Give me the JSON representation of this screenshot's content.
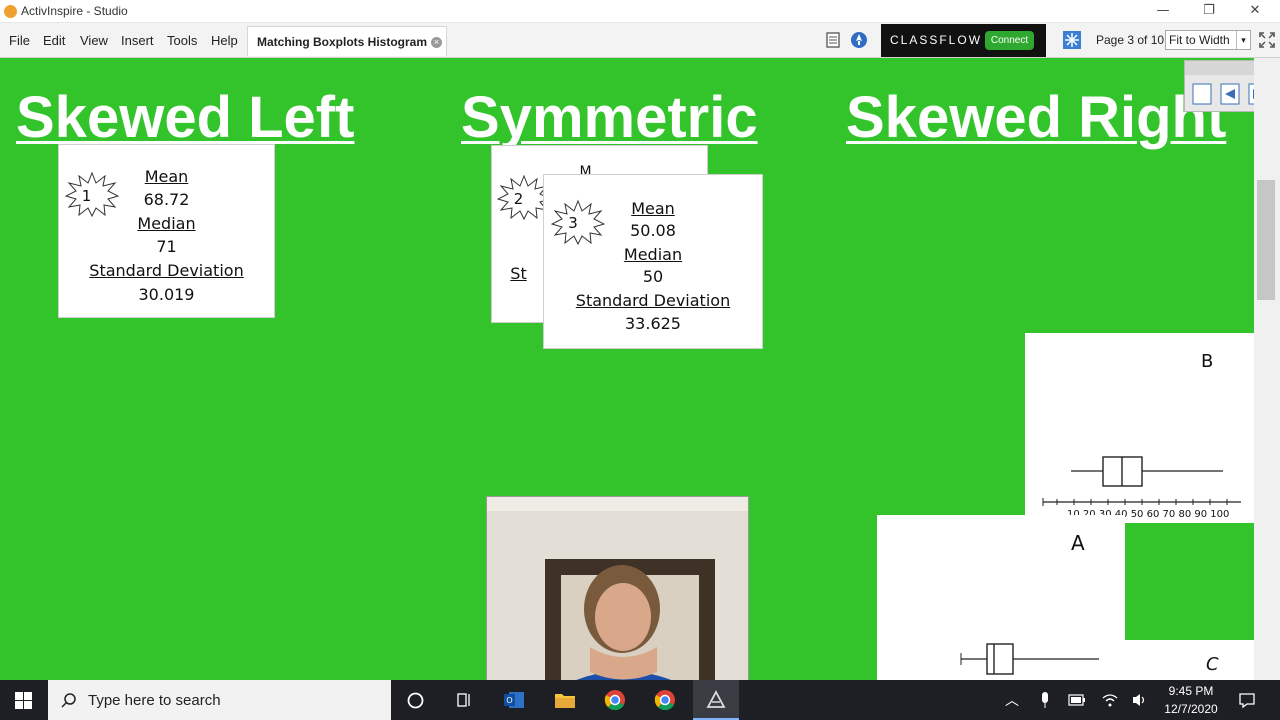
{
  "window": {
    "title": "ActivInspire - Studio",
    "minimize_glyph": "—",
    "maximize_glyph": "❐",
    "close_glyph": "✕"
  },
  "menu": {
    "items": [
      "File",
      "Edit",
      "View",
      "Insert",
      "Tools",
      "Help"
    ]
  },
  "document_tab": {
    "label": "Matching Boxplots Histogram",
    "close_glyph": "×"
  },
  "toolbar": {
    "classflow_brand": "CLASSFLOW",
    "classflow_connect": "Connect",
    "page_indicator": "Page 3 of 10",
    "zoom_value": "Fit to Width",
    "zoom_arrow": "▾"
  },
  "flipchart": {
    "headings": [
      "Skewed Left",
      "Symmetric",
      "Skewed Right"
    ],
    "card1": {
      "badge": "1",
      "mean_label": "Mean",
      "mean_value": "68.72",
      "median_label": "Median",
      "median_value": "71",
      "sd_label": "Standard Deviation",
      "sd_value": "30.019"
    },
    "card2": {
      "badge": "2",
      "mean_label_fragment": "M",
      "sd_label_fragment": "St"
    },
    "card3": {
      "badge": "3",
      "mean_label": "Mean",
      "mean_value": "50.08",
      "median_label": "Median",
      "median_value": "50",
      "sd_label": "Standard Deviation",
      "sd_value": "33.625"
    },
    "boxplot_b": {
      "label": "B",
      "axis_ticks": [
        "10",
        "20",
        "30",
        "40",
        "50",
        "60",
        "70",
        "80",
        "90",
        "100"
      ]
    },
    "boxplot_a": {
      "label": "A"
    },
    "boxplot_c": {
      "label": "C"
    }
  },
  "taskbar": {
    "search_placeholder": "Type here to search",
    "time": "9:45 PM",
    "date": "12/7/2020"
  },
  "colors": {
    "canvas_green": "#33c42c",
    "heading_text": "#ffffff",
    "taskbar_bg": "#1e1f24",
    "connect_green": "#2fa82f"
  }
}
